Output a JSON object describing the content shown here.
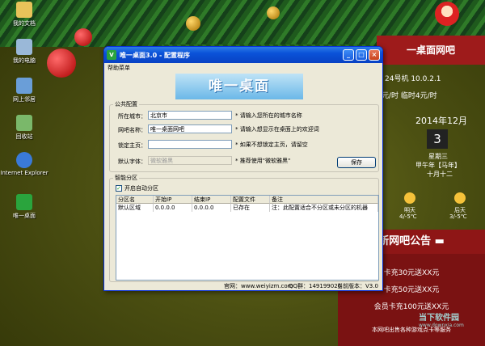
{
  "desktop": {
    "icons": [
      "我的文档",
      "我的电脑",
      "网上邻居",
      "回收站",
      "Internet Explorer",
      "唯一桌面"
    ]
  },
  "right_panel": {
    "brand": "一桌面网吧",
    "machine": "24号机 10.0.2.1",
    "price": "元/时 临时4元/时",
    "date": "2014年12月",
    "day": "3",
    "weekday": "星期三",
    "lunar_year": "甲午年【马年】",
    "lunar_day": "十月十二",
    "weather_tomorrow_label": "明天",
    "weather_tomorrow_temp": "4/-5℃",
    "weather_after_label": "后天",
    "weather_after_temp": "3/-5℃",
    "notice_title": "新网吧公告",
    "notices": [
      "卡充30元送XX元",
      "卡充50元送XX元",
      "会员卡充100元送XX元"
    ],
    "footer": "本网吧出售各种游戏点卡等服务",
    "watermark": "当下软件园",
    "watermark_url": "www.downxia.com"
  },
  "window": {
    "title": "唯一桌面3.0 - 配置程序",
    "menu": "帮助菜单",
    "banner": "唯一桌面",
    "public": {
      "legend": "公共配置",
      "city_label": "所在城市：",
      "city_value": "北京市",
      "city_hint": "* 请输入您所在的城市名称",
      "name_label": "网吧名称：",
      "name_value": "唯一桌面网吧",
      "name_hint": "* 请输入想显示在桌面上的欢迎词",
      "home_label": "锁定主页：",
      "home_value": "",
      "home_hint": "* 如果不想锁定主页，请留空",
      "font_label": "默认字体：",
      "font_value": "微软雅黑",
      "font_hint": "* 推荐使用\"微软雅黑\"",
      "save": "保存"
    },
    "partition": {
      "legend": "智能分区",
      "checkbox": "开启自动分区",
      "headers": [
        "分区名",
        "开始IP",
        "结束IP",
        "配置文件",
        "备注"
      ],
      "rows": [
        [
          "默认区域",
          "0.0.0.0",
          "0.0.0.0",
          "已存在",
          "注：此配置适合不分区或未分区的机器"
        ]
      ]
    },
    "status": {
      "website": "官网：www.weiyizm.com",
      "qq": "QQ群：149199026",
      "version": "当前版本：V3.0"
    }
  }
}
